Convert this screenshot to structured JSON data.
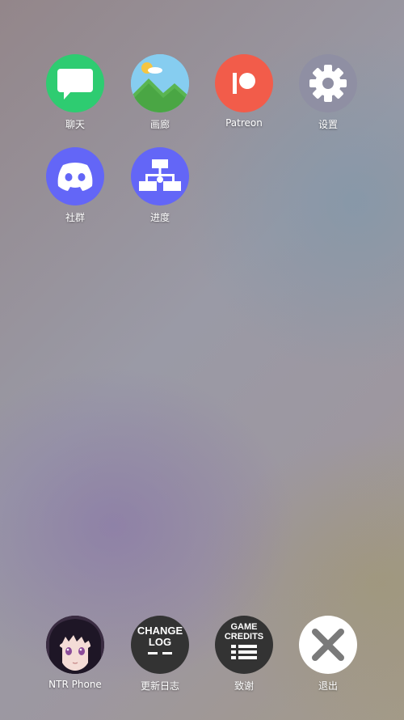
{
  "apps_top": [
    {
      "id": "chat",
      "label": "聊天",
      "icon": "chat-bubble-icon",
      "color": "#2ecc71"
    },
    {
      "id": "gallery",
      "label": "画廊",
      "icon": "landscape-icon",
      "color": "#7fc7ee"
    },
    {
      "id": "patreon",
      "label": "Patreon",
      "icon": "patreon-icon",
      "color": "#f25c4a"
    },
    {
      "id": "settings",
      "label": "设置",
      "icon": "gear-icon",
      "color": "#8f8fa3"
    },
    {
      "id": "community",
      "label": "社群",
      "icon": "discord-icon",
      "color": "#6366f7"
    },
    {
      "id": "progress",
      "label": "进度",
      "icon": "flowchart-icon",
      "color": "#6366f7"
    }
  ],
  "dock": [
    {
      "id": "ntr-phone",
      "label": "NTR Phone",
      "icon": "character-avatar-icon"
    },
    {
      "id": "changelog",
      "label": "更新日志",
      "icon_text": [
        "CHANGE",
        "LOG"
      ],
      "icon": "changelog-icon"
    },
    {
      "id": "credits",
      "label": "致谢",
      "icon_text": [
        "GAME",
        "CREDITS"
      ],
      "icon": "credits-icon"
    },
    {
      "id": "exit",
      "label": "退出",
      "icon": "close-icon"
    }
  ]
}
